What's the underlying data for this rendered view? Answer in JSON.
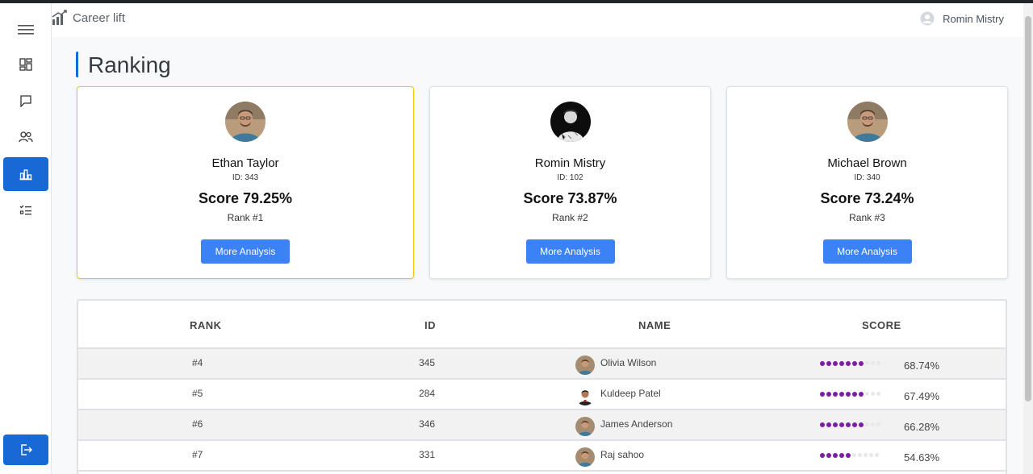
{
  "app": {
    "brand": "Career lift",
    "user_name": "Romin Mistry"
  },
  "sidebar": {
    "items": [
      {
        "name": "dashboard-icon",
        "active": false
      },
      {
        "name": "chat-icon",
        "active": false
      },
      {
        "name": "users-icon",
        "active": false
      },
      {
        "name": "ranking-chart-icon",
        "active": true
      },
      {
        "name": "task-list-icon",
        "active": false
      }
    ],
    "logout": "logout-icon"
  },
  "page": {
    "title": "Ranking"
  },
  "top_cards": [
    {
      "name": "Ethan Taylor",
      "id": "ID: 343",
      "score": "Score 79.25%",
      "rank": "Rank #1",
      "button": "More Analysis"
    },
    {
      "name": "Romin Mistry",
      "id": "ID: 102",
      "score": "Score 73.87%",
      "rank": "Rank #2",
      "button": "More Analysis"
    },
    {
      "name": "Michael Brown",
      "id": "ID: 340",
      "score": "Score 73.24%",
      "rank": "Rank #3",
      "button": "More Analysis"
    }
  ],
  "table": {
    "headers": {
      "rank": "RANK",
      "id": "ID",
      "name": "NAME",
      "score": "SCORE"
    },
    "rows": [
      {
        "rank": "#4",
        "id": "345",
        "name": "Olivia Wilson",
        "score": "68.74%",
        "score_value": 68.74
      },
      {
        "rank": "#5",
        "id": "284",
        "name": "Kuldeep Patel",
        "score": "67.49%",
        "score_value": 67.49
      },
      {
        "rank": "#6",
        "id": "346",
        "name": "James Anderson",
        "score": "66.28%",
        "score_value": 66.28
      },
      {
        "rank": "#7",
        "id": "331",
        "name": "Raj sahoo",
        "score": "54.63%",
        "score_value": 54.63
      }
    ]
  },
  "colors": {
    "accent": "#1769d6",
    "button": "#3b82f6",
    "dots": "#7b1fa2",
    "gold_border": "#f1c40f"
  }
}
